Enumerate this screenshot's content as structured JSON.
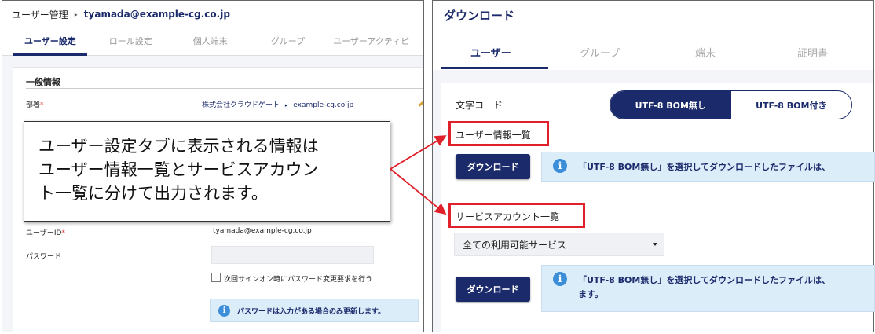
{
  "left": {
    "breadcrumb_root": "ユーザー管理",
    "breadcrumb_sep": "▸",
    "breadcrumb_user": "tyamada@example-cg.co.jp",
    "tabs": [
      {
        "label": "ユーザー設定",
        "active": true
      },
      {
        "label": "ロール設定",
        "active": false
      },
      {
        "label": "個人端末",
        "active": false
      },
      {
        "label": "グループ",
        "active": false
      },
      {
        "label": "ユーザーアクティビ",
        "active": false
      }
    ],
    "section_title": "一般情報",
    "department_label": "部署",
    "required_mark": "*",
    "department_value": "株式会社クラウドゲート",
    "department_sep": "▸",
    "department_domain": "example-cg.co.jp",
    "userid_label": "ユーザーID",
    "userid_value": "tyamada@example-cg.co.jp",
    "password_label": "パスワード",
    "checkbox_label": "次回サインオン時にパスワード変更要求を行う",
    "info_text": "パスワードは入力がある場合のみ更新します。"
  },
  "callout": {
    "lines": [
      "ユーザー設定タブに表示される情報は",
      "ユーザー情報一覧とサービスアカウン",
      "ト一覧に分けて出力されます。"
    ]
  },
  "right": {
    "title": "ダウンロード",
    "tabs": [
      {
        "label": "ユーザー",
        "active": true
      },
      {
        "label": "グループ",
        "active": false
      },
      {
        "label": "端末",
        "active": false
      },
      {
        "label": "証明書",
        "active": false
      }
    ],
    "charset_label": "文字コード",
    "charset_options": [
      {
        "label": "UTF-8 BOM無し",
        "selected": true
      },
      {
        "label": "UTF-8 BOM付き",
        "selected": false
      }
    ],
    "user_list_label": "ユーザー情報一覧",
    "download_label": "ダウンロード",
    "info_text_1": "「UTF-8 BOM無し」を選択してダウンロードしたファイルは、",
    "service_list_label": "サービスアカウント一覧",
    "service_select_value": "全ての利用可能サービス",
    "download_label_2": "ダウンロード",
    "info_text_2": "「UTF-8 BOM無し」を選択してダウンロードしたファイルは、",
    "info_text_2b": "ます。"
  },
  "colors": {
    "brand": "#1b2a6b",
    "highlight": "#e0202a",
    "info_bg": "#dcedfa",
    "info_icon": "#3c8ed9"
  },
  "icons": [
    "info-icon",
    "pencil-icon",
    "caret-down-icon",
    "breadcrumb-arrow-icon"
  ]
}
